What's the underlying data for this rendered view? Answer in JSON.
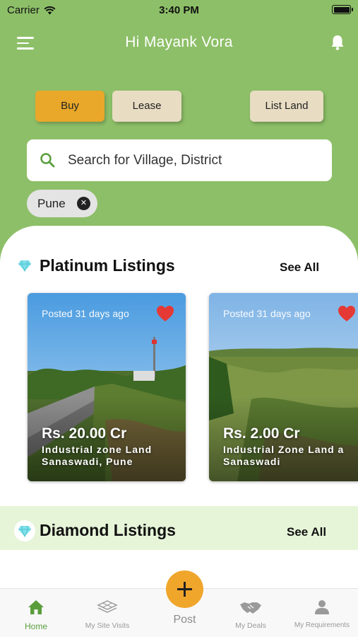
{
  "status_bar": {
    "carrier": "Carrier",
    "time": "3:40 PM"
  },
  "header": {
    "greeting": "Hi Mayank Vora"
  },
  "actions": {
    "buy": "Buy",
    "lease": "Lease",
    "list_land": "List Land"
  },
  "search": {
    "placeholder": "Search for Village, District"
  },
  "filter_chip": {
    "label": "Pune"
  },
  "platinum": {
    "title": "Platinum Listings",
    "see_all": "See All",
    "cards": [
      {
        "posted": "Posted 31 days ago",
        "price": "Rs. 20.00 Cr",
        "line1": "Industrial zone Land",
        "line2": "Sanaswadi, Pune"
      },
      {
        "posted": "Posted 31 days ago",
        "price": "Rs. 2.00 Cr",
        "line1": "Industrial Zone Land a",
        "line2": "Sanaswadi"
      }
    ]
  },
  "diamond": {
    "title": "Diamond Listings",
    "see_all": "See All"
  },
  "tabbar": {
    "home": "Home",
    "site_visits": "My Site Visits",
    "post": "Post",
    "deals": "My Deals",
    "requirements": "My Requirements"
  },
  "colors": {
    "background": "#8dbf68",
    "accent": "#f0a62b",
    "buy_button": "#e9a82a",
    "secondary_button": "#e8dcc3",
    "heart": "#e53935",
    "active_tab": "#5a9e3c"
  }
}
